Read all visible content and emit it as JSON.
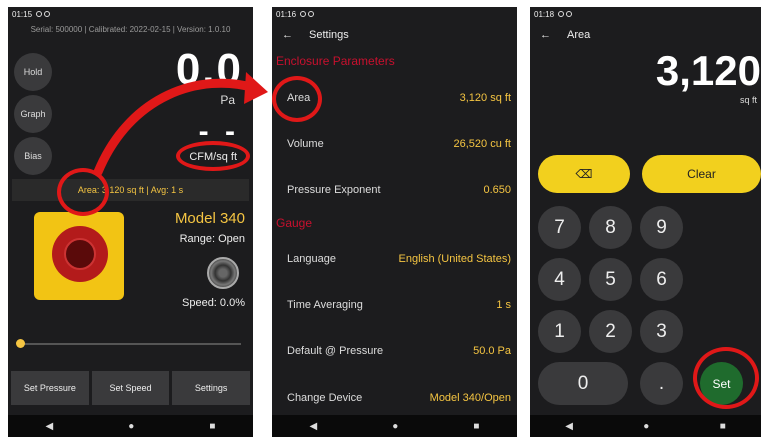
{
  "phone1": {
    "time": "01:15",
    "info": "Serial: 500000 | Calibrated: 2022-02-15 | Version: 1.0.10",
    "side_buttons": [
      "Hold",
      "Graph",
      "Bias"
    ],
    "reading": "0.0",
    "unit_pressure": "Pa",
    "dashes": "- -",
    "unit_flow": "CFM/sq ft",
    "area_bar": "Area: 3,120 sq ft | Avg: 1 s",
    "model": "Model 340",
    "range": "Range: Open",
    "speed": "Speed: 0.0%",
    "bottom_buttons": [
      "Set Pressure",
      "Set Speed",
      "Settings"
    ]
  },
  "phone2": {
    "time": "01:16",
    "title": "Settings",
    "section_enclosure": "Enclosure Parameters",
    "enclosure_rows": [
      {
        "label": "Area",
        "value": "3,120 sq ft"
      },
      {
        "label": "Volume",
        "value": "26,520 cu ft"
      },
      {
        "label": "Pressure Exponent",
        "value": "0.650"
      }
    ],
    "section_gauge": "Gauge",
    "gauge_rows": [
      {
        "label": "Language",
        "value": "English (United States)"
      },
      {
        "label": "Time Averaging",
        "value": "1 s"
      },
      {
        "label": "Default @ Pressure",
        "value": "50.0 Pa"
      },
      {
        "label": "Change Device",
        "value": "Model 340/Open"
      }
    ]
  },
  "phone3": {
    "time": "01:18",
    "title": "Area",
    "value": "3,120",
    "unit": "sq ft",
    "clear_label": "Clear",
    "backspace_glyph": "⌫",
    "keys": [
      "7",
      "8",
      "9",
      "4",
      "5",
      "6",
      "1",
      "2",
      "3"
    ],
    "zero": "0",
    "dot": ".",
    "set_label": "Set"
  },
  "nav_glyphs": {
    "back": "◀",
    "home": "●",
    "recent": "■"
  },
  "colors": {
    "accent": "#f5c542",
    "section": "#c8102e",
    "annotation": "#e01818",
    "set": "#1f6b2d"
  }
}
